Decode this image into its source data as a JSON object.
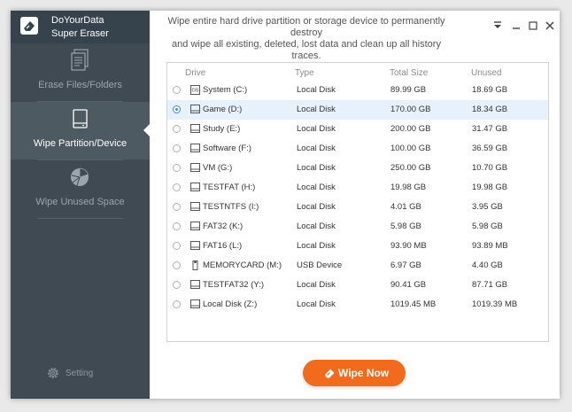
{
  "app": {
    "brand_line1": "DoYourData",
    "brand_line2": "Super Eraser"
  },
  "header": {
    "description_line1": "Wipe entire hard drive partition or storage device to permanently destroy",
    "description_line2": "and wipe all existing, deleted, lost data and clean up all history traces."
  },
  "window_controls": [
    "pin-icon",
    "minimize-icon",
    "maximize-icon",
    "close-icon"
  ],
  "sidebar": {
    "items": [
      {
        "label": "Erase Files/Folders",
        "icon": "files-icon",
        "active": false
      },
      {
        "label": "Wipe Partition/Device",
        "icon": "hard-drive-icon",
        "active": true
      },
      {
        "label": "Wipe Unused Space",
        "icon": "pie-chart-icon",
        "active": false
      }
    ],
    "setting_label": "Setting"
  },
  "table": {
    "columns": [
      "Drive",
      "Type",
      "Total Size",
      "Unused"
    ],
    "rows": [
      {
        "name": "System (C:)",
        "type": "Local Disk",
        "total": "89.99 GB",
        "unused": "18.69 GB",
        "icon": "os-drive-icon",
        "selected": false
      },
      {
        "name": "Game (D:)",
        "type": "Local Disk",
        "total": "170.00 GB",
        "unused": "18.34 GB",
        "icon": "drive-icon",
        "selected": true
      },
      {
        "name": "Study (E:)",
        "type": "Local Disk",
        "total": "200.00 GB",
        "unused": "31.47 GB",
        "icon": "drive-icon",
        "selected": false
      },
      {
        "name": "Software (F:)",
        "type": "Local Disk",
        "total": "100.00 GB",
        "unused": "36.59 GB",
        "icon": "drive-icon",
        "selected": false
      },
      {
        "name": "VM (G:)",
        "type": "Local Disk",
        "total": "250.00 GB",
        "unused": "10.70 GB",
        "icon": "drive-icon",
        "selected": false
      },
      {
        "name": "TESTFAT (H:)",
        "type": "Local Disk",
        "total": "19.98 GB",
        "unused": "19.98 GB",
        "icon": "drive-icon",
        "selected": false
      },
      {
        "name": "TESTNTFS (I:)",
        "type": "Local Disk",
        "total": "4.01 GB",
        "unused": "3.95 GB",
        "icon": "drive-icon",
        "selected": false
      },
      {
        "name": "FAT32 (K:)",
        "type": "Local Disk",
        "total": "5.98 GB",
        "unused": "5.98 GB",
        "icon": "drive-icon",
        "selected": false
      },
      {
        "name": "FAT16 (L:)",
        "type": "Local Disk",
        "total": "93.90 MB",
        "unused": "93.89 MB",
        "icon": "drive-icon",
        "selected": false
      },
      {
        "name": "MEMORYCARD (M:)",
        "type": "USB Device",
        "total": "6.97 GB",
        "unused": "4.40 GB",
        "icon": "usb-icon",
        "selected": false
      },
      {
        "name": "TESTFAT32 (Y:)",
        "type": "Local Disk",
        "total": "90.41 GB",
        "unused": "87.71 GB",
        "icon": "drive-icon",
        "selected": false
      },
      {
        "name": "Local Disk (Z:)",
        "type": "Local Disk",
        "total": "1019.45 MB",
        "unused": "1019.39 MB",
        "icon": "drive-icon",
        "selected": false
      }
    ]
  },
  "actions": {
    "wipe_label": "Wipe Now"
  },
  "colors": {
    "sidebar_bg": "#3f4a52",
    "accent_orange": "#f26a1b",
    "selected_row": "#e7f1fb"
  }
}
